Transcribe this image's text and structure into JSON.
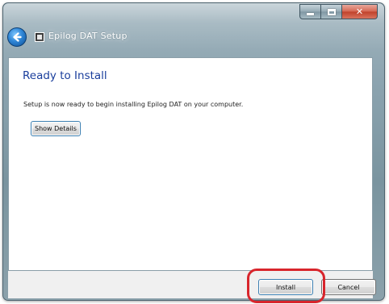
{
  "window": {
    "title": "Epilog DAT Setup",
    "icons": {
      "back": "back-arrow-icon",
      "app": "setup-app-icon",
      "minimize": "minimize-icon",
      "maximize": "maximize-icon",
      "close": "close-icon"
    },
    "close_glyph": "✕"
  },
  "page": {
    "heading": "Ready to Install",
    "status": "Setup is now ready to begin installing Epilog DAT on your computer.",
    "show_details_label": "Show Details"
  },
  "footer": {
    "install_label": "Install",
    "cancel_label": "Cancel"
  },
  "colors": {
    "heading": "#1a3e9c",
    "highlight": "#d8252c",
    "button_focus_border": "#3c7fb1"
  }
}
